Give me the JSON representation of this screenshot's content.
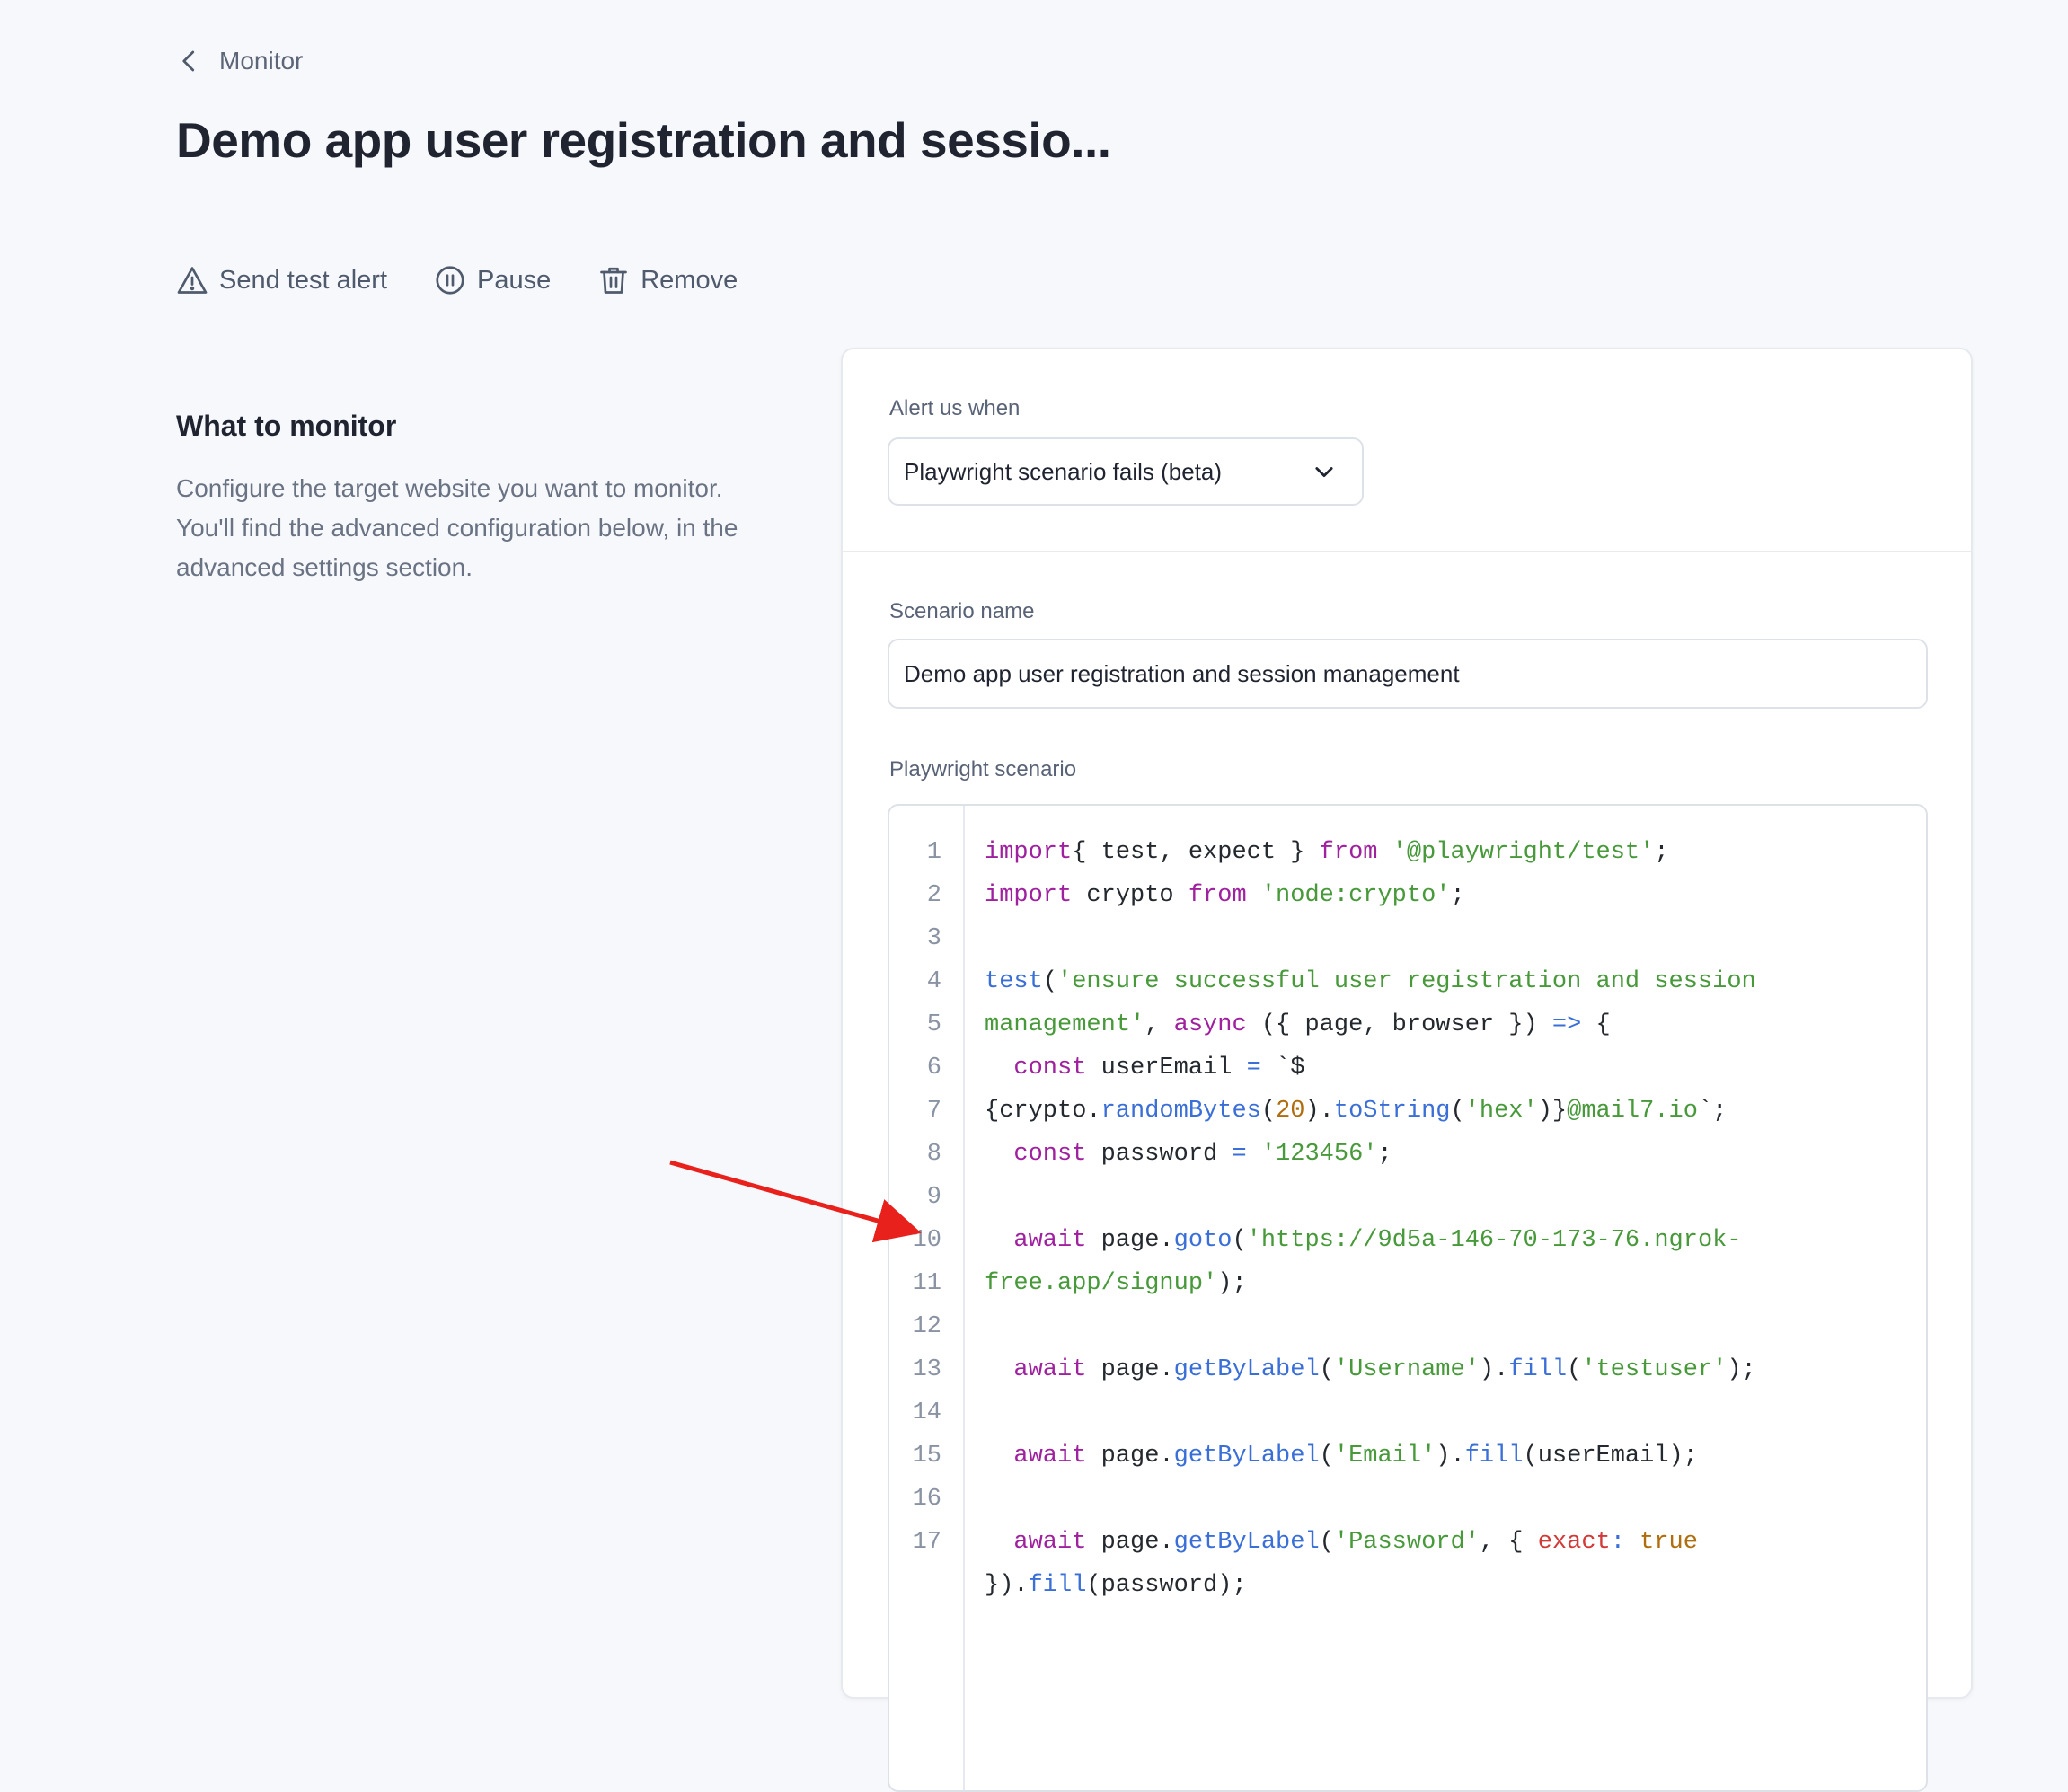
{
  "back_link": {
    "label": "Monitor",
    "icon": "chevron-left-icon"
  },
  "page_title": "Demo app user registration and sessio...",
  "actions": {
    "send_test_alert": "Send test alert",
    "pause": "Pause",
    "remove": "Remove"
  },
  "section": {
    "heading": "What to monitor",
    "description": "Configure the target website you want to monitor. You'll find the advanced configuration below, in the advanced settings section."
  },
  "alert": {
    "label": "Alert us when",
    "selected": "Playwright scenario fails (beta)"
  },
  "scenario": {
    "name_label": "Scenario name",
    "name_value": "Demo app user registration and session management",
    "code_label": "Playwright scenario"
  },
  "code": {
    "lines": [
      {
        "n": "1",
        "parts": [
          [
            "kw",
            "import"
          ],
          [
            "",
            "{ test, expect } "
          ],
          [
            "kw",
            "from"
          ],
          [
            "",
            " "
          ],
          [
            "str",
            "'@playwright/test'"
          ],
          [
            "",
            ";"
          ]
        ]
      },
      {
        "n": "2",
        "parts": [
          [
            "kw",
            "import"
          ],
          [
            "",
            " crypto "
          ],
          [
            "kw",
            "from"
          ],
          [
            "",
            " "
          ],
          [
            "str",
            "'node:crypto'"
          ],
          [
            "",
            ";"
          ]
        ]
      },
      {
        "n": "3",
        "parts": []
      },
      {
        "n": "4",
        "parts": [
          [
            "fn",
            "test"
          ],
          [
            "",
            "("
          ],
          [
            "str",
            "'ensure successful user registration and session"
          ]
        ]
      },
      {
        "n": "",
        "parts": [
          [
            "str",
            "management'"
          ],
          [
            "",
            ", "
          ],
          [
            "kw",
            "async"
          ],
          [
            "",
            " ({ page, browser }) "
          ],
          [
            "fn",
            "=>"
          ],
          [
            "",
            " {"
          ]
        ]
      },
      {
        "n": "5",
        "parts": [
          [
            "",
            "  "
          ],
          [
            "kw",
            "const"
          ],
          [
            "",
            " userEmail "
          ],
          [
            "fn",
            "="
          ],
          [
            "",
            " `$"
          ]
        ]
      },
      {
        "n": "",
        "parts": [
          [
            "",
            "{crypto."
          ],
          [
            "fn",
            "randomBytes"
          ],
          [
            "",
            "("
          ],
          [
            "num",
            "20"
          ],
          [
            "",
            ")."
          ],
          [
            "fn",
            "toString"
          ],
          [
            "",
            "("
          ],
          [
            "str",
            "'hex'"
          ],
          [
            "",
            ")}"
          ],
          [
            "str",
            "@mail7.io"
          ],
          [
            "",
            "`;"
          ]
        ]
      },
      {
        "n": "6",
        "parts": [
          [
            "",
            "  "
          ],
          [
            "kw",
            "const"
          ],
          [
            "",
            " password "
          ],
          [
            "fn",
            "="
          ],
          [
            "",
            " "
          ],
          [
            "str",
            "'123456'"
          ],
          [
            "",
            ";"
          ]
        ]
      },
      {
        "n": "7",
        "parts": []
      },
      {
        "n": "8",
        "parts": [
          [
            "",
            "  "
          ],
          [
            "kw",
            "await"
          ],
          [
            "",
            " page."
          ],
          [
            "fn",
            "goto"
          ],
          [
            "",
            "("
          ],
          [
            "str",
            "'https://9d5a-146-70-173-76.ngrok-"
          ]
        ]
      },
      {
        "n": "",
        "parts": [
          [
            "str",
            "free.app/signup'"
          ],
          [
            "",
            ");"
          ]
        ]
      },
      {
        "n": "9",
        "parts": []
      },
      {
        "n": "10",
        "parts": [
          [
            "",
            "  "
          ],
          [
            "kw",
            "await"
          ],
          [
            "",
            " page."
          ],
          [
            "fn",
            "getByLabel"
          ],
          [
            "",
            "("
          ],
          [
            "str",
            "'Username'"
          ],
          [
            "",
            ")."
          ],
          [
            "fn",
            "fill"
          ],
          [
            "",
            "("
          ],
          [
            "str",
            "'testuser'"
          ],
          [
            "",
            ");"
          ]
        ]
      },
      {
        "n": "11",
        "parts": []
      },
      {
        "n": "12",
        "parts": [
          [
            "",
            "  "
          ],
          [
            "kw",
            "await"
          ],
          [
            "",
            " page."
          ],
          [
            "fn",
            "getByLabel"
          ],
          [
            "",
            "("
          ],
          [
            "str",
            "'Email'"
          ],
          [
            "",
            ")."
          ],
          [
            "fn",
            "fill"
          ],
          [
            "",
            "(userEmail);"
          ]
        ]
      },
      {
        "n": "13",
        "parts": []
      },
      {
        "n": "14",
        "parts": [
          [
            "",
            "  "
          ],
          [
            "kw",
            "await"
          ],
          [
            "",
            " page."
          ],
          [
            "fn",
            "getByLabel"
          ],
          [
            "",
            "("
          ],
          [
            "str",
            "'Password'"
          ],
          [
            "",
            ", { "
          ],
          [
            "prop",
            "exact"
          ],
          [
            "fn",
            ":"
          ],
          [
            "",
            " "
          ],
          [
            "bool",
            "true"
          ]
        ]
      },
      {
        "n": "",
        "parts": [
          [
            "",
            "})."
          ],
          [
            "fn",
            "fill"
          ],
          [
            "",
            "(password);"
          ]
        ]
      },
      {
        "n": "15",
        "parts": []
      },
      {
        "n": "16",
        "parts": []
      },
      {
        "n": "17",
        "parts": []
      }
    ]
  },
  "colors": {
    "accent_annotation": "#e8211c",
    "keyword": "#a0219f",
    "string": "#47993a",
    "function": "#3b6fd8"
  }
}
